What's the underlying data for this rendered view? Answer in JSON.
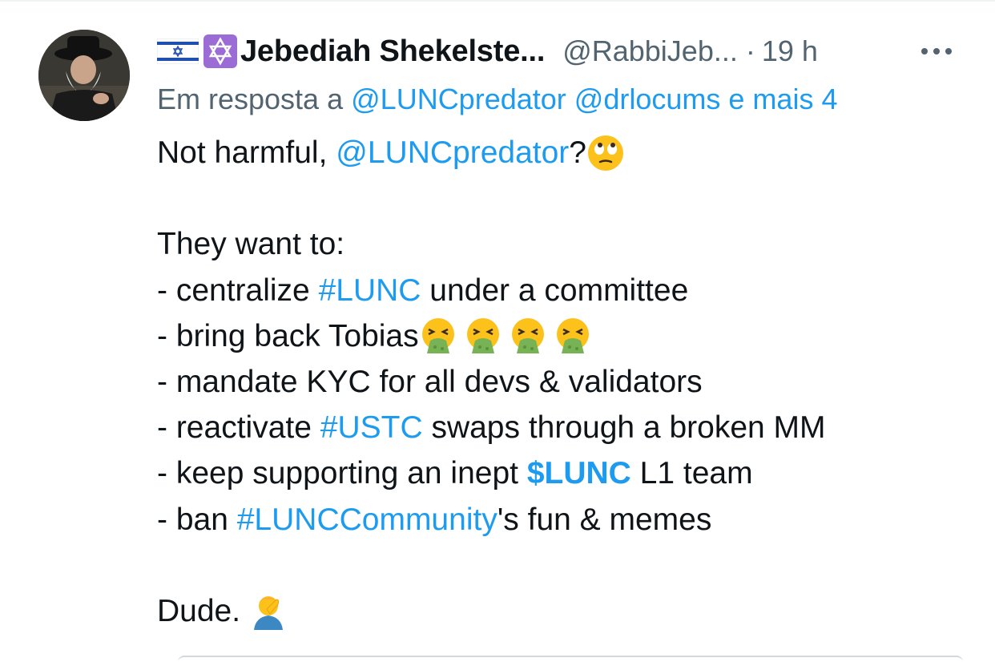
{
  "tweet": {
    "author_name": "Jebediah Shekelste...",
    "handle": "@RabbiJeb...",
    "separator": "·",
    "time": "19 h",
    "reply_prefix": "Em resposta a",
    "reply_user1": "@LUNCpredator",
    "reply_user2": "@drlocums",
    "reply_more": "e mais 4",
    "lines": {
      "l1_a": "Not harmful, ",
      "l1_mention": "@LUNCpredator",
      "l1_b": "?",
      "l3": "They want to:",
      "l4_a": "- centralize ",
      "l4_tag": "#LUNC",
      "l4_b": " under a committee",
      "l5_a": "- bring back Tobias",
      "l6": "- mandate KYC for all devs & validators",
      "l7_a": "- reactivate ",
      "l7_tag": "#USTC",
      "l7_b": " swaps through a broken MM",
      "l8_a": "- keep supporting an inept ",
      "l8_cash": "$LUNC",
      "l8_b": " L1 team",
      "l9_a": "- ban ",
      "l9_tag": "#LUNCCommunity",
      "l9_b": "'s fun & memes",
      "l11": "Dude. "
    },
    "icons": {
      "flag": "israel-flag-icon",
      "badge": "star-of-david-icon",
      "more": "more-horizontal-icon",
      "eye_roll": "face-with-rolling-eyes-emoji",
      "vomit": "face-vomiting-emoji",
      "facepalm": "person-facepalming-emoji"
    },
    "colors": {
      "link": "#1d9bf0",
      "muted": "#536471",
      "text": "#0f1419"
    }
  }
}
